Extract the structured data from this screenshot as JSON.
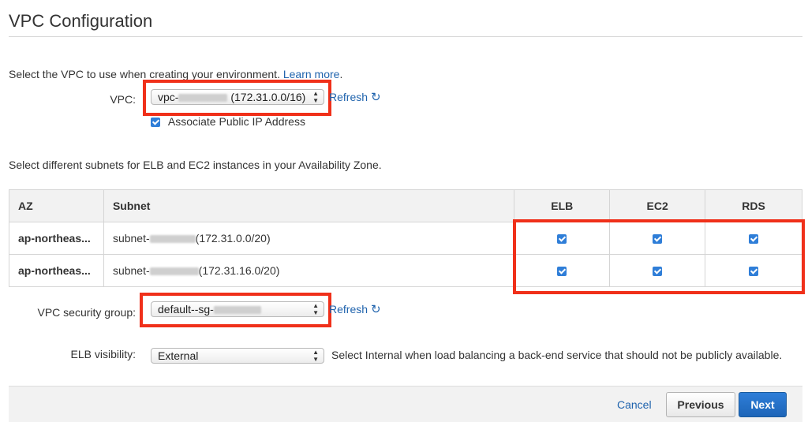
{
  "page": {
    "title": "VPC Configuration"
  },
  "vpc": {
    "intro_text": "Select the VPC to use when creating your environment.",
    "learn_more": "Learn more",
    "intro_suffix": ".",
    "label": "VPC:",
    "select_prefix": "vpc-",
    "select_cidr": "(172.31.0.0/16)",
    "refresh": "Refresh",
    "associate_public_ip": "Associate Public IP Address",
    "associate_checked": true
  },
  "subnets": {
    "intro": "Select different subnets for ELB and EC2 instances in your Availability Zone.",
    "headers": [
      "AZ",
      "Subnet",
      "ELB",
      "EC2",
      "RDS"
    ],
    "rows": [
      {
        "az": "ap-northeas...",
        "subnet_prefix": "subnet-",
        "cidr": "(172.31.0.0/20)",
        "elb": true,
        "ec2": true,
        "rds": true
      },
      {
        "az": "ap-northeas...",
        "subnet_prefix": "subnet-",
        "cidr": "(172.31.16.0/20)",
        "elb": true,
        "ec2": true,
        "rds": true
      }
    ]
  },
  "security_group": {
    "label": "VPC security group:",
    "select_prefix": "default--sg-",
    "refresh": "Refresh"
  },
  "elb_visibility": {
    "label": "ELB visibility:",
    "value": "External",
    "hint": "Select Internal when load balancing a back-end service that should not be publicly available."
  },
  "footer": {
    "cancel": "Cancel",
    "previous": "Previous",
    "next": "Next"
  },
  "colors": {
    "link": "#1f63ad",
    "highlight": "#f0301a",
    "primary": "#2f7ed8"
  },
  "icons": {
    "refresh": "refresh-icon",
    "select_arrows": "select-arrows-icon",
    "checkbox": "checkbox-icon"
  }
}
